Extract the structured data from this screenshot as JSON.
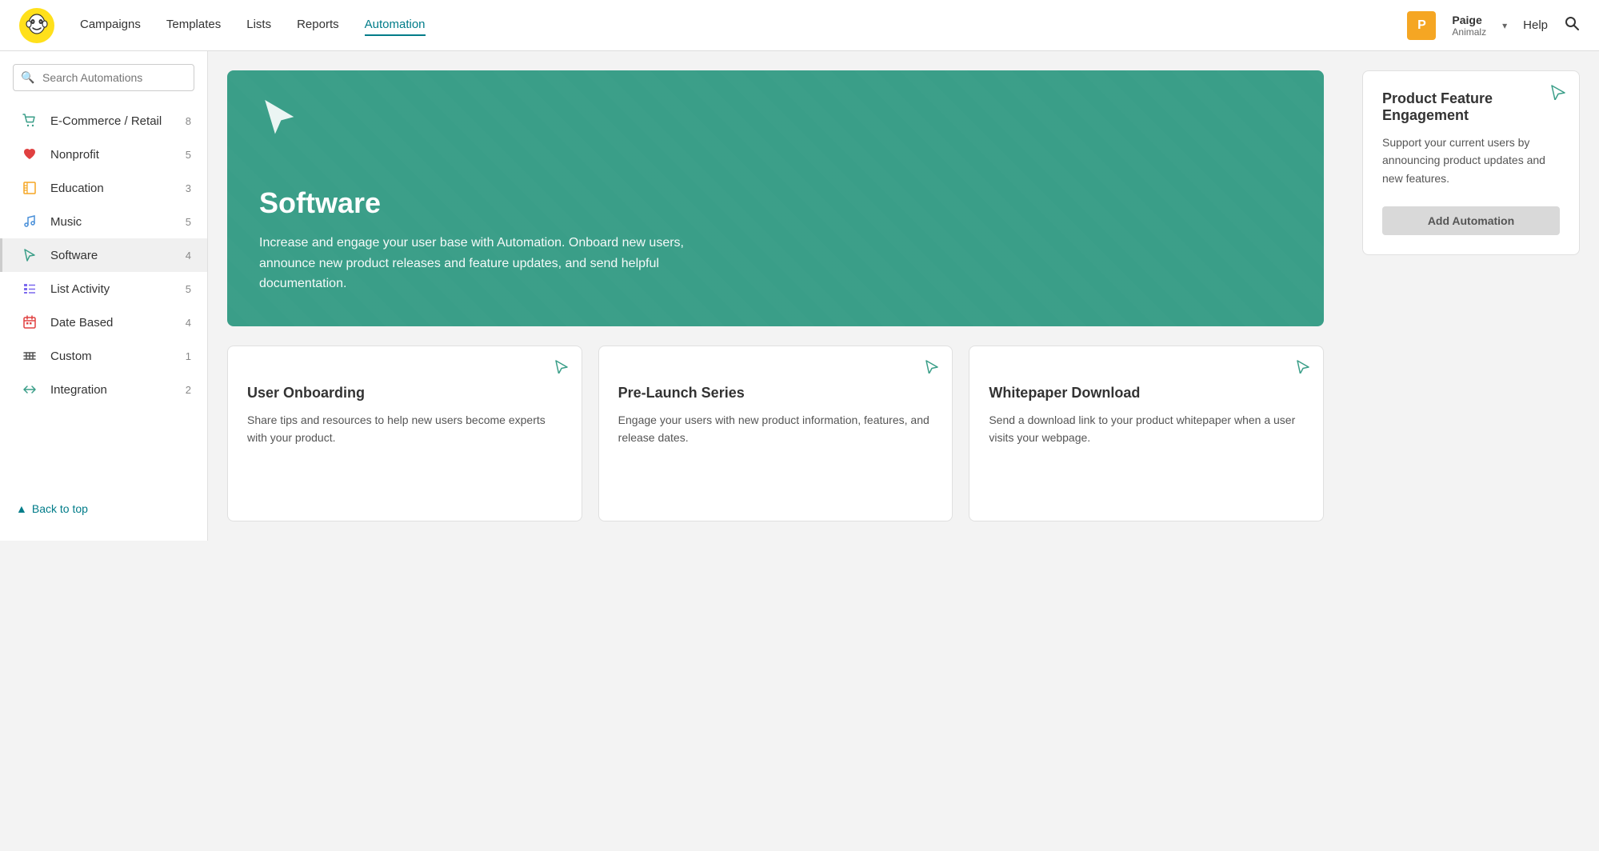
{
  "nav": {
    "links": [
      "Campaigns",
      "Templates",
      "Lists",
      "Reports",
      "Automation"
    ],
    "active_link": "Automation",
    "help": "Help",
    "user": {
      "initial": "P",
      "name": "Paige",
      "org": "Animalz",
      "badge_color": "#f5a623"
    }
  },
  "sidebar": {
    "search_placeholder": "Search Automations",
    "items": [
      {
        "id": "ecommerce",
        "label": "E-Commerce / Retail",
        "count": 8,
        "icon": "cart",
        "active": false
      },
      {
        "id": "nonprofit",
        "label": "Nonprofit",
        "count": 5,
        "icon": "heart",
        "active": false
      },
      {
        "id": "education",
        "label": "Education",
        "count": 3,
        "icon": "book",
        "active": false
      },
      {
        "id": "music",
        "label": "Music",
        "count": 5,
        "icon": "music",
        "active": false
      },
      {
        "id": "software",
        "label": "Software",
        "count": 4,
        "icon": "cursor",
        "active": true
      },
      {
        "id": "list-activity",
        "label": "List Activity",
        "count": 5,
        "icon": "list",
        "active": false
      },
      {
        "id": "date-based",
        "label": "Date Based",
        "count": 4,
        "icon": "calendar",
        "active": false
      },
      {
        "id": "custom",
        "label": "Custom",
        "count": 1,
        "icon": "bars",
        "active": false
      },
      {
        "id": "integration",
        "label": "Integration",
        "count": 2,
        "icon": "arrows",
        "active": false
      }
    ],
    "back_to_top": "Back to top"
  },
  "hero": {
    "title": "Software",
    "description": "Increase and engage your user base with Automation. Onboard new users, announce new product releases and feature updates, and send helpful documentation.",
    "bg_color": "#3a9e88"
  },
  "feature_card": {
    "title": "Product Feature Engagement",
    "description": "Support your current users by announcing product updates and new features.",
    "button_label": "Add Automation"
  },
  "small_cards": [
    {
      "title": "User Onboarding",
      "description": "Share tips and resources to help new users become experts with your product."
    },
    {
      "title": "Pre-Launch Series",
      "description": "Engage your users with new product information, features, and release dates."
    },
    {
      "title": "Whitepaper Download",
      "description": "Send a download link to your product whitepaper when a user visits your webpage."
    }
  ]
}
